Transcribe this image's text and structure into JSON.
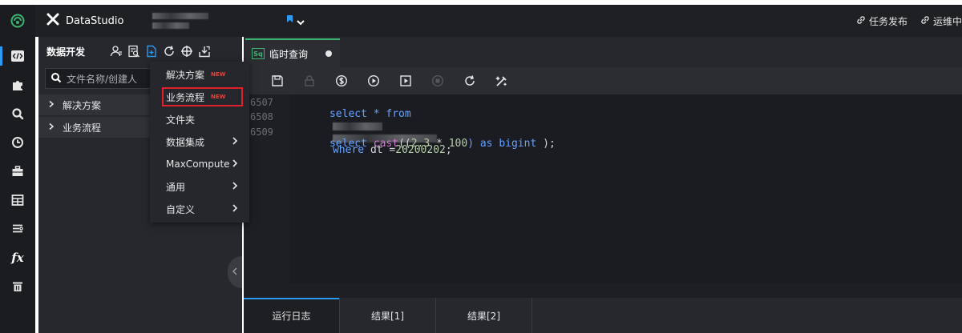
{
  "app": {
    "title": "DataStudio"
  },
  "top_right": {
    "links": [
      "任务发布",
      "运维中"
    ]
  },
  "left_rail": {
    "icons": [
      "code-icon",
      "puzzle-icon",
      "search-icon",
      "clock-icon",
      "briefcase-icon",
      "table-icon",
      "list-icon",
      "function-icon",
      "trash-icon"
    ],
    "fx_label": "fx"
  },
  "panel": {
    "title": "数据开发",
    "search_placeholder": "文件名称/创建人",
    "tree": [
      "解决方案",
      "业务流程"
    ]
  },
  "menu": {
    "items": [
      {
        "label": "解决方案",
        "badge": "NEW",
        "submenu": false
      },
      {
        "label": "业务流程",
        "badge": "NEW",
        "submenu": false
      },
      {
        "label": "文件夹",
        "badge": "",
        "submenu": false
      },
      {
        "label": "数据集成",
        "badge": "",
        "submenu": true
      },
      {
        "label": "MaxCompute",
        "badge": "",
        "submenu": true
      },
      {
        "label": "通用",
        "badge": "",
        "submenu": true
      },
      {
        "label": "自定义",
        "badge": "",
        "submenu": true
      }
    ]
  },
  "editor": {
    "tab": {
      "badge": "Sq",
      "label": "临时查询"
    },
    "lines": [
      {
        "num": "6507",
        "code": "select * from",
        "tail": "where dt =20200202;"
      },
      {
        "num": "6508",
        "code": ""
      },
      {
        "num": "6509",
        "code": "select cast((2.3 * 100) as bigint );"
      }
    ]
  },
  "bottom_tabs": [
    "运行日志",
    "结果[1]",
    "结果[2]"
  ],
  "colors": {
    "accent_blue": "#2b9af3",
    "accent_green": "#3cb371",
    "new_red": "#e0463a",
    "highlight_red": "#e0202a"
  }
}
